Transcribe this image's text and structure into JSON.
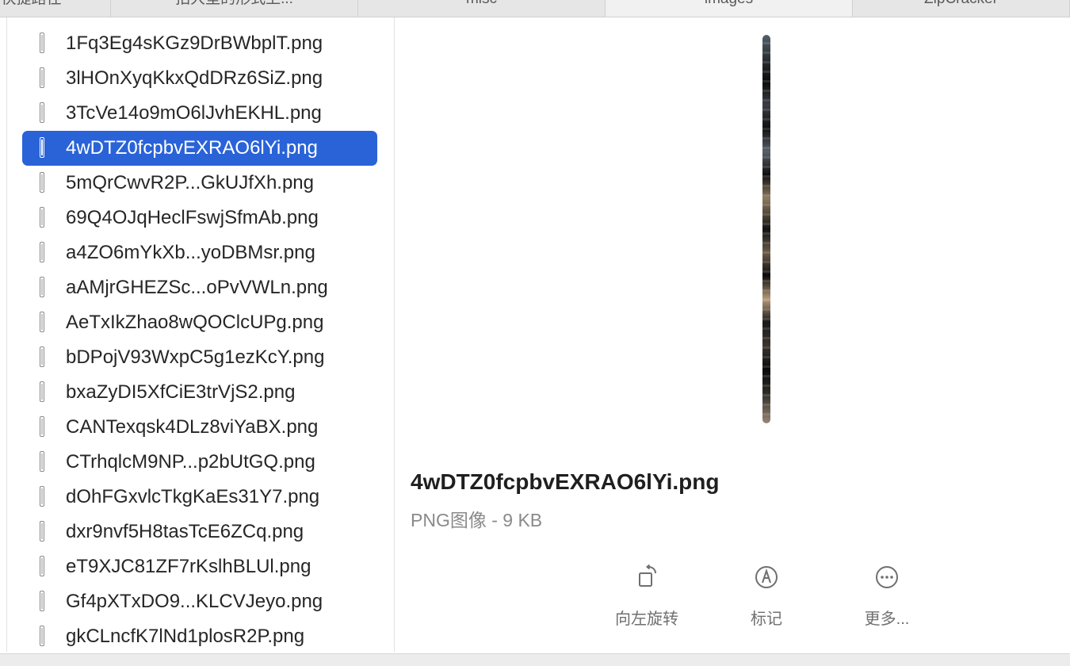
{
  "tabs": [
    {
      "label": "快捷路径"
    },
    {
      "label": "拍大型的形式上..."
    },
    {
      "label": "misc"
    },
    {
      "label": "images",
      "active": true
    },
    {
      "label": "ZipCracker"
    }
  ],
  "files": [
    {
      "name": "1Fq3Eg4sKGz9DrBWbplT.png"
    },
    {
      "name": "3lHOnXyqKkxQdDRz6SiZ.png"
    },
    {
      "name": "3TcVe14o9mO6lJvhEKHL.png"
    },
    {
      "name": "4wDTZ0fcpbvEXRAO6lYi.png",
      "selected": true
    },
    {
      "name": "5mQrCwvR2P...GkUJfXh.png"
    },
    {
      "name": "69Q4OJqHeclFswjSfmAb.png"
    },
    {
      "name": "a4ZO6mYkXb...yoDBMsr.png"
    },
    {
      "name": "aAMjrGHEZSc...oPvVWLn.png"
    },
    {
      "name": "AeTxIkZhao8wQOClcUPg.png"
    },
    {
      "name": "bDPojV93WxpC5g1ezKcY.png"
    },
    {
      "name": "bxaZyDI5XfCiE3trVjS2.png"
    },
    {
      "name": "CANTexqsk4DLz8viYaBX.png"
    },
    {
      "name": "CTrhqlcM9NP...p2bUtGQ.png"
    },
    {
      "name": "dOhFGxvlcTkgKaEs31Y7.png"
    },
    {
      "name": "dxr9nvf5H8tasTcE6ZCq.png"
    },
    {
      "name": "eT9XJC81ZF7rKslhBLUl.png"
    },
    {
      "name": "Gf4pXTxDO9...KLCVJeyo.png"
    },
    {
      "name": "gkCLncfK7lNd1plosR2P.png"
    }
  ],
  "preview": {
    "title": "4wDTZ0fcpbvEXRAO6lYi.png",
    "meta": "PNG图像 - 9 KB",
    "actions": [
      {
        "label": "向左旋转",
        "icon": "rotate-left-icon"
      },
      {
        "label": "标记",
        "icon": "markup-icon"
      },
      {
        "label": "更多...",
        "icon": "more-icon"
      }
    ]
  },
  "colors": {
    "selection": "#2a63d8",
    "tabbar": "#e6e6e6"
  }
}
